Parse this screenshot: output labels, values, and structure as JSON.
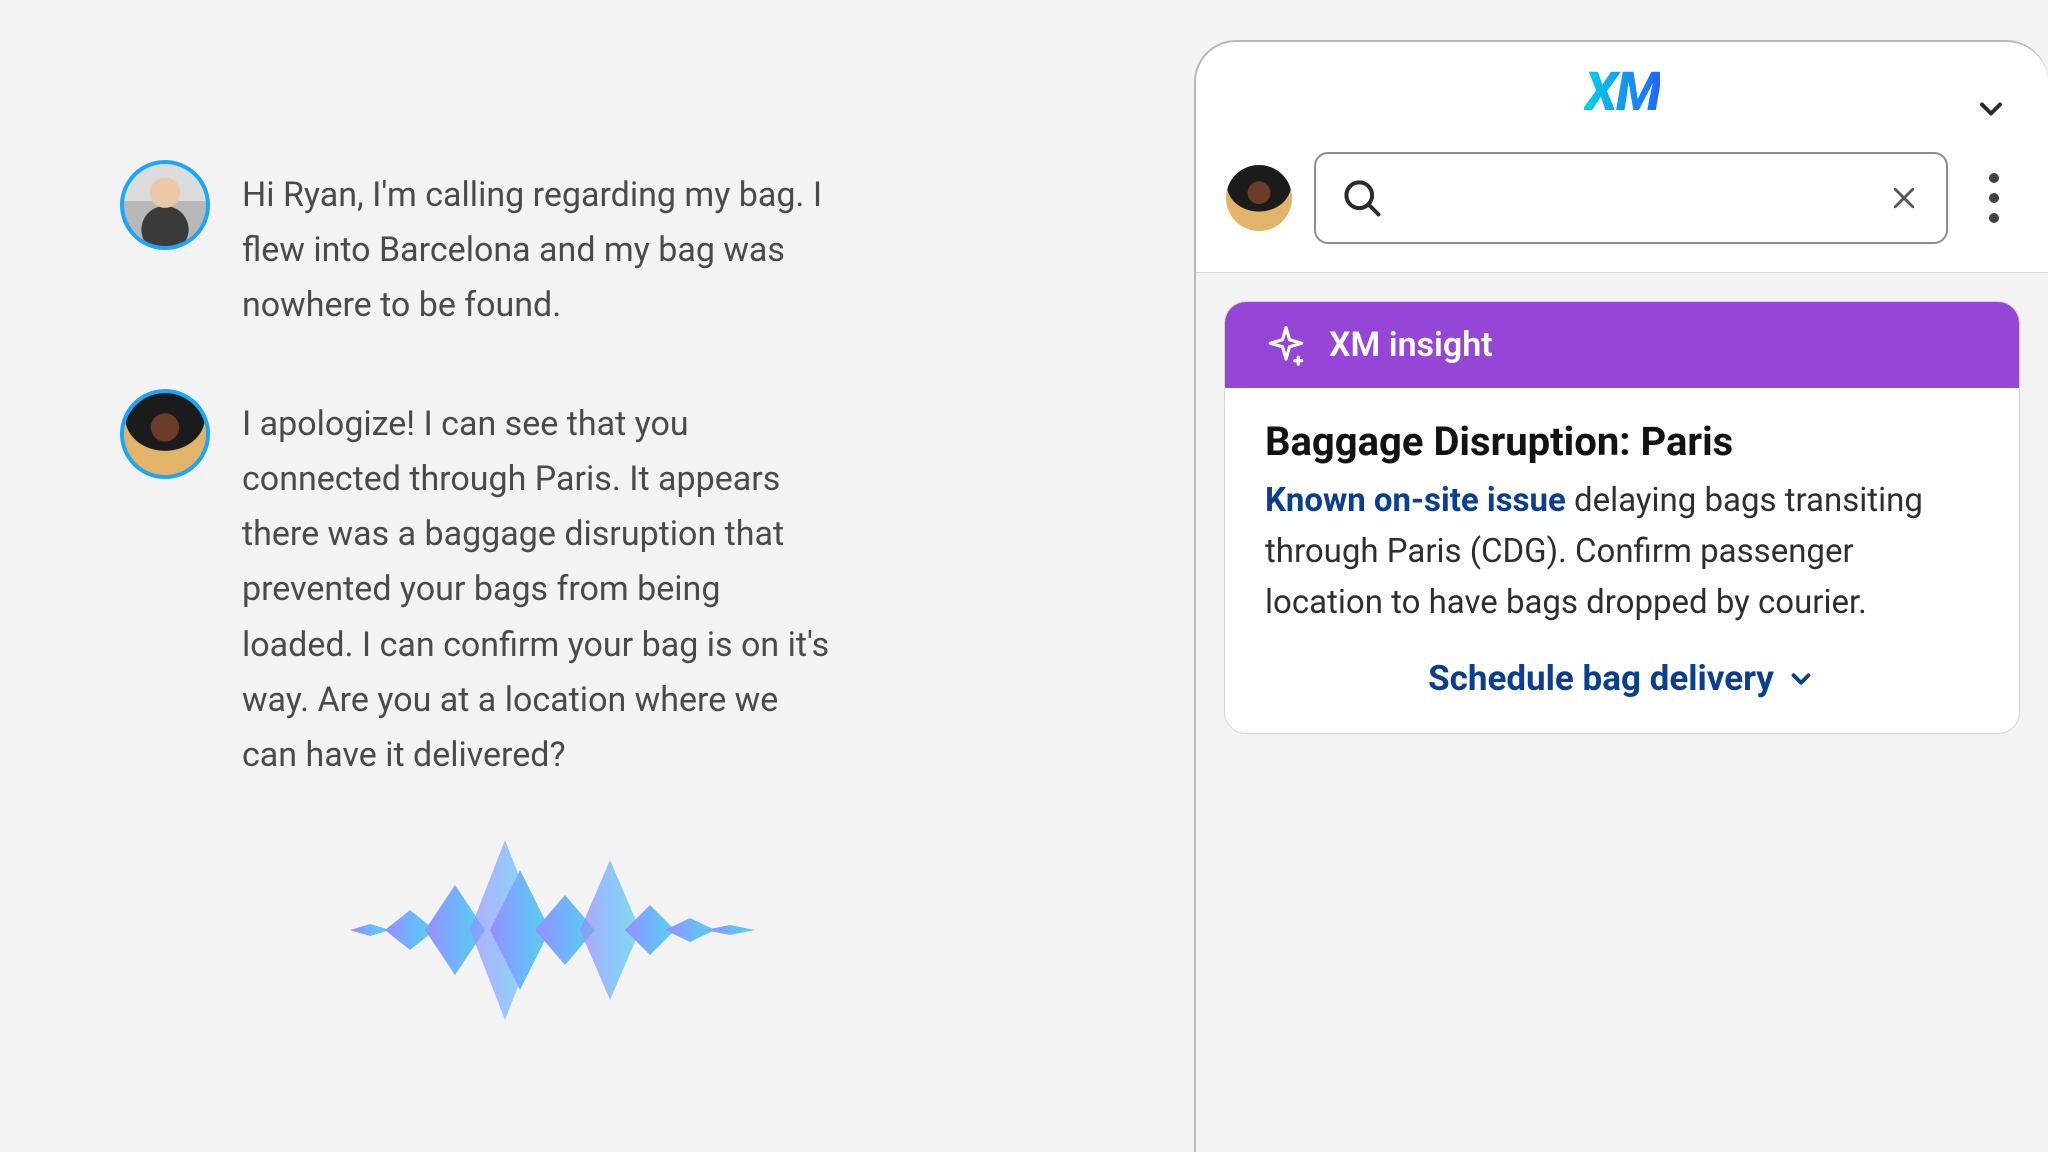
{
  "transcript": {
    "messages": [
      {
        "role": "customer",
        "text": "Hi Ryan, I'm calling regarding my bag. I flew into Barcelona and my bag was nowhere to be found."
      },
      {
        "role": "agent",
        "text": "I apologize! I can see that you connected through Paris. It appears there was a baggage disruption that prevented your bags from being loaded. I can confirm your bag is on it's way. Are you at a location where we can have it delivered?"
      }
    ]
  },
  "panel": {
    "logo_text": "XM",
    "search": {
      "value": "",
      "placeholder": ""
    },
    "insight": {
      "header_label": "XM insight",
      "title": "Baggage Disruption: Paris",
      "link_text": "Known on-site issue",
      "desc_rest": " delaying bags transiting through Paris (CDG). Confirm passenger location to have bags dropped by courier.",
      "action_label": "Schedule bag delivery"
    }
  },
  "colors": {
    "accent_purple": "#9646d6",
    "link_navy": "#0a3e8f",
    "avatar_ring": "#1aa6ff"
  }
}
